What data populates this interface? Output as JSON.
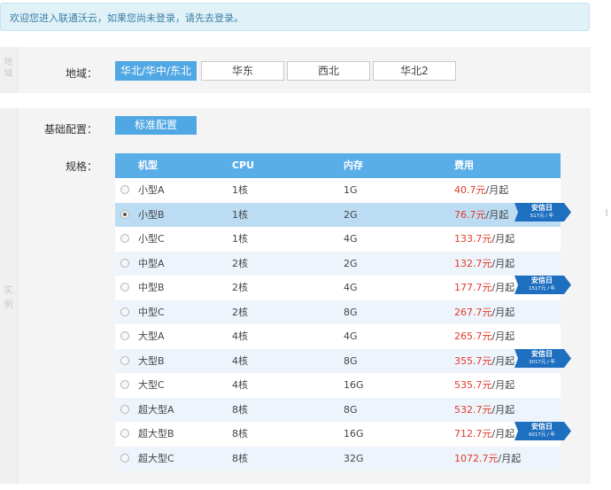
{
  "notice": {
    "text": "欢迎您进入联通沃云，如果您尚未登录，请先去登录。"
  },
  "region_section": {
    "side_label": [
      "地",
      "域"
    ],
    "label": "地域：",
    "options": [
      "华北/华中/东北",
      "华东",
      "西北",
      "华北2"
    ],
    "selected_index": 0
  },
  "instance_section": {
    "side_label": [
      "实",
      "例"
    ],
    "config_label": "基础配置：",
    "config_button": "标准配置",
    "spec_label": "规格：",
    "table": {
      "headers": [
        "机型",
        "CPU",
        "内存",
        "费用"
      ],
      "selected_index": 1,
      "rows": [
        {
          "name": "小型A",
          "cpu": "1核",
          "mem": "1G",
          "price": "40.7元",
          "unit": "/月起",
          "promo": null
        },
        {
          "name": "小型B",
          "cpu": "1核",
          "mem": "2G",
          "price": "76.7元",
          "unit": "/月起",
          "promo": {
            "title": "安信日",
            "price": "517元 / 年"
          }
        },
        {
          "name": "小型C",
          "cpu": "1核",
          "mem": "4G",
          "price": "133.7元",
          "unit": "/月起",
          "promo": null
        },
        {
          "name": "中型A",
          "cpu": "2核",
          "mem": "2G",
          "price": "132.7元",
          "unit": "/月起",
          "promo": null
        },
        {
          "name": "中型B",
          "cpu": "2核",
          "mem": "4G",
          "price": "177.7元",
          "unit": "/月起",
          "promo": {
            "title": "安信日",
            "price": "1517元 / 年"
          }
        },
        {
          "name": "中型C",
          "cpu": "2核",
          "mem": "8G",
          "price": "267.7元",
          "unit": "/月起",
          "promo": null
        },
        {
          "name": "大型A",
          "cpu": "4核",
          "mem": "4G",
          "price": "265.7元",
          "unit": "/月起",
          "promo": null
        },
        {
          "name": "大型B",
          "cpu": "4核",
          "mem": "8G",
          "price": "355.7元",
          "unit": "/月起",
          "promo": {
            "title": "安信日",
            "price": "3017元 / 年"
          }
        },
        {
          "name": "大型C",
          "cpu": "4核",
          "mem": "16G",
          "price": "535.7元",
          "unit": "/月起",
          "promo": null
        },
        {
          "name": "超大型A",
          "cpu": "8核",
          "mem": "8G",
          "price": "532.7元",
          "unit": "/月起",
          "promo": null
        },
        {
          "name": "超大型B",
          "cpu": "8核",
          "mem": "16G",
          "price": "712.7元",
          "unit": "/月起",
          "promo": {
            "title": "安信日",
            "price": "6017元 / 年"
          }
        },
        {
          "name": "超大型C",
          "cpu": "8核",
          "mem": "32G",
          "price": "1072.7元",
          "unit": "/月起",
          "promo": null
        }
      ]
    }
  },
  "colors": {
    "accent": "#4fa7e3",
    "table_header": "#5aaee8",
    "price": "#e23a2a",
    "promo_ribbon": "#1e6fc0"
  }
}
